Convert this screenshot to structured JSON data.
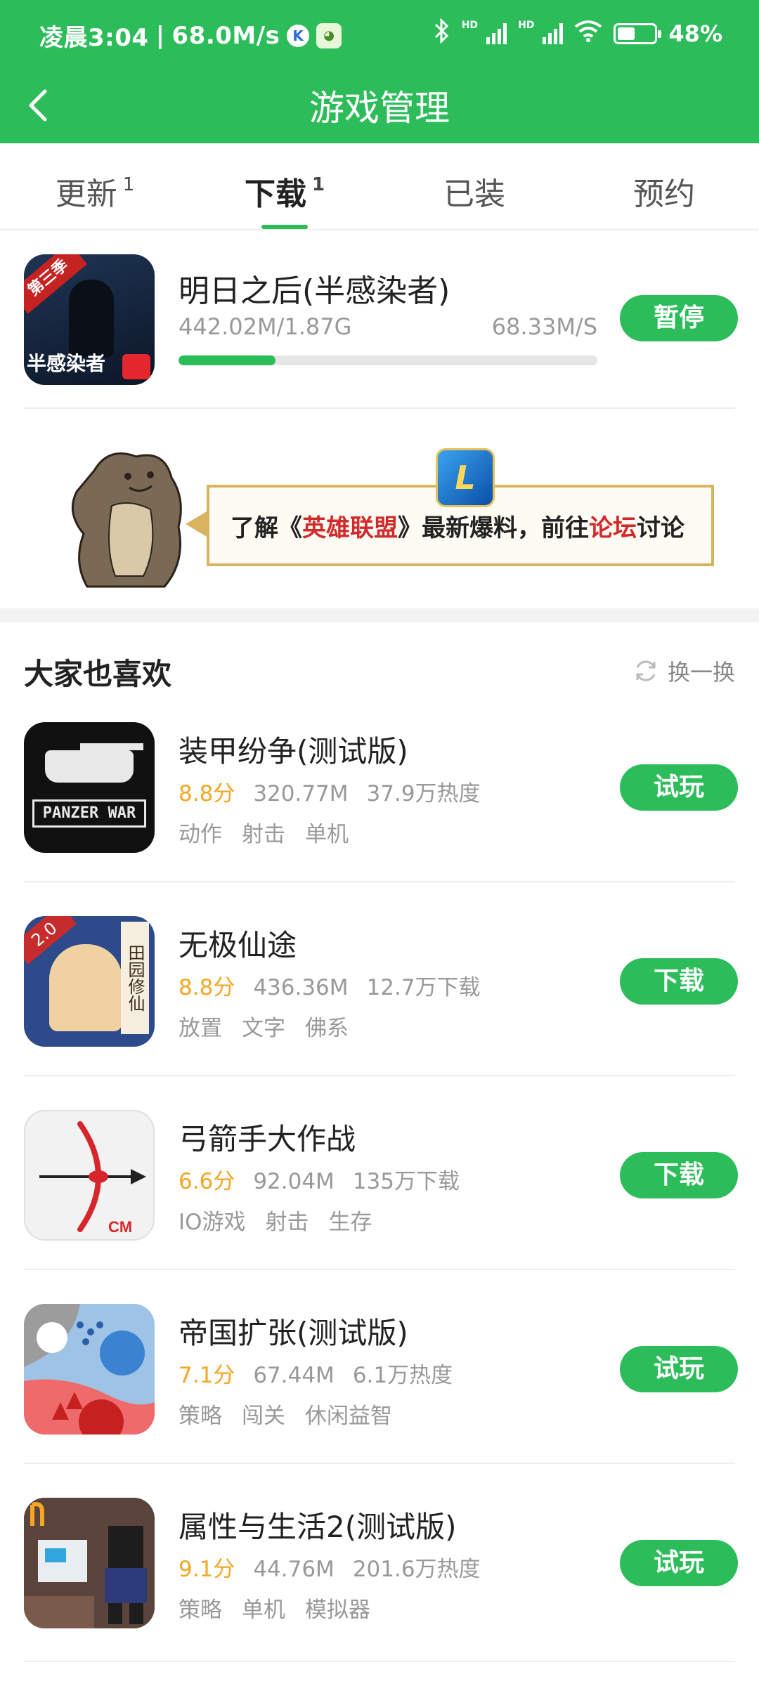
{
  "status_bar": {
    "time": "凌晨3:04",
    "speed": "68.0M/s",
    "k_badge": "K",
    "battery": "48%",
    "battery_level": 0.48,
    "icons": [
      "bluetooth-icon",
      "signal-icon",
      "signal-icon",
      "wifi-icon",
      "battery-icon"
    ]
  },
  "header": {
    "title": "游戏管理",
    "back_icon": "chevron-left-icon"
  },
  "tabs": [
    {
      "label": "更新",
      "badge": "1",
      "active": false
    },
    {
      "label": "下载",
      "badge": "1",
      "active": true
    },
    {
      "label": "已装",
      "badge": "",
      "active": false
    },
    {
      "label": "预约",
      "badge": "",
      "active": false
    }
  ],
  "downloading": {
    "name": "明日之后(半感染者)",
    "icon_season": "第三季",
    "icon_label": "半感染者",
    "size": "442.02M/1.87G",
    "speed": "68.33M/S",
    "progress": 0.231,
    "button": "暂停"
  },
  "banner": {
    "text_parts": [
      "了解《",
      "英雄联盟",
      "》最新爆料，前往",
      "论坛",
      "讨论"
    ],
    "logo_letter": "L"
  },
  "recommend": {
    "title": "大家也喜欢",
    "refresh_label": "换一换",
    "items": [
      {
        "name": "装甲纷争(测试版)",
        "score": "8.8分",
        "size": "320.77M",
        "stat": "37.9万热度",
        "tags": [
          "动作",
          "射击",
          "单机"
        ],
        "button": "试玩",
        "icon_text": "PANZER WAR"
      },
      {
        "name": "无极仙途",
        "score": "8.8分",
        "size": "436.36M",
        "stat": "12.7万下载",
        "tags": [
          "放置",
          "文字",
          "佛系"
        ],
        "button": "下载",
        "icon_text": "田园修仙",
        "icon_badge": "2.0"
      },
      {
        "name": "弓箭手大作战",
        "score": "6.6分",
        "size": "92.04M",
        "stat": "135万下载",
        "tags": [
          "IO游戏",
          "射击",
          "生存"
        ],
        "button": "下载",
        "icon_text": "CM"
      },
      {
        "name": "帝国扩张(测试版)",
        "score": "7.1分",
        "size": "67.44M",
        "stat": "6.1万热度",
        "tags": [
          "策略",
          "闯关",
          "休闲益智"
        ],
        "button": "试玩"
      },
      {
        "name": "属性与生活2(测试版)",
        "score": "9.1分",
        "size": "44.76M",
        "stat": "201.6万热度",
        "tags": [
          "策略",
          "单机",
          "模拟器"
        ],
        "button": "试玩"
      }
    ]
  },
  "colors": {
    "primary": "#2dbc5a",
    "score": "#f5a623",
    "accent_red": "#d22a2a"
  }
}
